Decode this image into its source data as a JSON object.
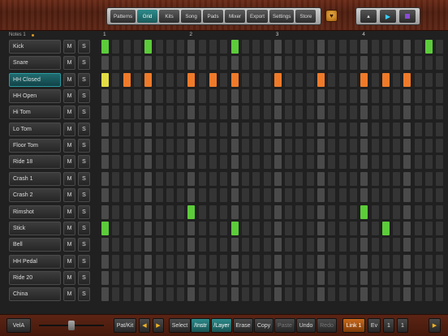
{
  "menu": {
    "items": [
      "Patterns",
      "Grid",
      "Kits",
      "Song",
      "Pads",
      "Mixer",
      "Export",
      "Settings",
      "Store"
    ],
    "active_index": 1
  },
  "transport": {
    "metronome_icon": "metronome-icon",
    "play_icon": "play-icon",
    "stop_icon": "stop-icon"
  },
  "notes_label": "Notes 1",
  "bar_numbers": [
    "1",
    "2",
    "3",
    "4"
  ],
  "rows": [
    {
      "name": "Kick",
      "m": "M",
      "s": "S"
    },
    {
      "name": "Snare",
      "m": "M",
      "s": "S"
    },
    {
      "name": "HH Closed",
      "m": "M",
      "s": "S",
      "selected": true
    },
    {
      "name": "HH Open",
      "m": "M",
      "s": "S"
    },
    {
      "name": "Hi Tom",
      "m": "M",
      "s": "S"
    },
    {
      "name": "Lo Tom",
      "m": "M",
      "s": "S"
    },
    {
      "name": "Floor Tom",
      "m": "M",
      "s": "S"
    },
    {
      "name": "Ride 18",
      "m": "M",
      "s": "S"
    },
    {
      "name": "Crash 1",
      "m": "M",
      "s": "S"
    },
    {
      "name": "Crash 2",
      "m": "M",
      "s": "S"
    },
    {
      "name": "Rimshot",
      "m": "M",
      "s": "S"
    },
    {
      "name": "Stick",
      "m": "M",
      "s": "S"
    },
    {
      "name": "Bell",
      "m": "M",
      "s": "S"
    },
    {
      "name": "HH Pedal",
      "m": "M",
      "s": "S"
    },
    {
      "name": "Ride 20",
      "m": "M",
      "s": "S"
    },
    {
      "name": "China",
      "m": "M",
      "s": "S"
    }
  ],
  "active_steps": {
    "0": {
      "0": "g",
      "4": "g",
      "12": "g",
      "30": "g"
    },
    "2": {
      "0": "y",
      "2": "o",
      "4": "o",
      "8": "o",
      "10": "o",
      "12": "o",
      "16": "o",
      "20": "o",
      "24": "o",
      "26": "o",
      "28": "o"
    },
    "10": {
      "8": "g",
      "24": "g"
    },
    "11": {
      "0": "g",
      "12": "g",
      "26": "g"
    }
  },
  "colors": {
    "green": "#5ccc3a",
    "orange": "#ef7a2a",
    "yellow": "#e2dc45",
    "teal": "#2d8a8a"
  },
  "bottom": {
    "vel": "VelA",
    "patkit": "Pat/Kit",
    "prev": "◀",
    "next": "▶",
    "select": "Select",
    "instr": "/Instr",
    "layer": "/Layer",
    "erase": "Erase",
    "copy": "Copy",
    "paste": "Paste",
    "undo": "Undo",
    "redo": "Redo",
    "link": "Link 1",
    "ev": "Ev",
    "one_a": "1",
    "one_b": "1",
    "right_arrow": "▶"
  }
}
